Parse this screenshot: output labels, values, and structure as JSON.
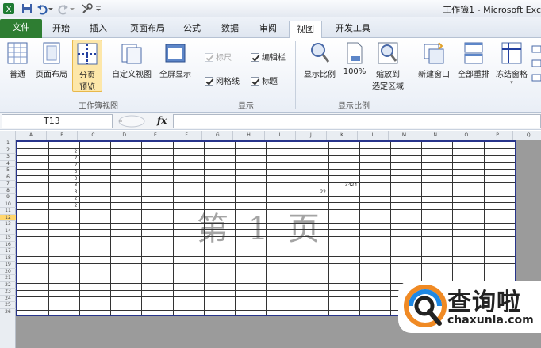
{
  "window": {
    "title": "工作簿1 - Microsoft Exc"
  },
  "tabs": [
    {
      "label": "文件"
    },
    {
      "label": "开始"
    },
    {
      "label": "插入"
    },
    {
      "label": "页面布局"
    },
    {
      "label": "公式"
    },
    {
      "label": "数据"
    },
    {
      "label": "审阅"
    },
    {
      "label": "视图"
    },
    {
      "label": "开发工具"
    }
  ],
  "ribbon": {
    "workbook_views": {
      "label": "工作簿视图",
      "normal": "普通",
      "page_layout": "页面布局",
      "page_break_line1": "分页",
      "page_break_line2": "预览",
      "custom_views": "自定义视图",
      "full_screen": "全屏显示"
    },
    "show": {
      "label": "显示",
      "ruler": "标尺",
      "formula_bar": "编辑栏",
      "gridlines": "网格线",
      "headings": "标题",
      "ruler_checked": true,
      "formula_bar_checked": true,
      "gridlines_checked": true,
      "headings_checked": true
    },
    "zoom": {
      "label": "显示比例",
      "zoom": "显示比例",
      "hundred": "100%",
      "zoom_to_selection_line1": "缩放到",
      "zoom_to_selection_line2": "选定区域"
    },
    "window_group": {
      "new_window": "新建窗口",
      "arrange_all": "全部重排",
      "freeze_panes": "冻结窗格"
    }
  },
  "formula_bar": {
    "name_box": "T13",
    "fx": "fx",
    "value": ""
  },
  "sheet": {
    "columns": [
      "A",
      "B",
      "C",
      "D",
      "E",
      "F",
      "G",
      "H",
      "I",
      "J",
      "K",
      "L",
      "M",
      "N",
      "O",
      "P",
      "Q"
    ],
    "rows": [
      "1",
      "2",
      "3",
      "4",
      "5",
      "6",
      "7",
      "8",
      "9",
      "10",
      "11",
      "12",
      "13",
      "14",
      "15",
      "16",
      "17",
      "18",
      "19",
      "20",
      "21",
      "22",
      "23",
      "24",
      "25",
      "26"
    ],
    "selected_row": "12",
    "watermark": "第 1 页",
    "cells": {
      "B2": "2",
      "B3": "2",
      "B4": "2",
      "B5": "3",
      "B6": "3",
      "B7": "3",
      "B8": "3",
      "B9": "2",
      "B10": "2",
      "J8": "22",
      "K7": "3424"
    }
  },
  "logo": {
    "name": "查询啦",
    "domain": "chaxunla.com"
  },
  "colors": {
    "file_tab": "#2e7d32",
    "page_border": "#27348b",
    "selected_row": "#ffd66e",
    "logo_accent": "#f08a24",
    "logo_blue": "#1e88e5"
  }
}
